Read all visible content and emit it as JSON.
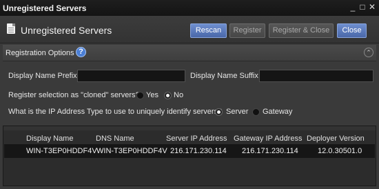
{
  "window": {
    "title": "Unregistered Servers",
    "controls": [
      "_",
      "□",
      "✕"
    ]
  },
  "header": {
    "title": "Unregistered Servers",
    "buttons": {
      "rescan": "Rescan",
      "register": "Register",
      "register_close": "Register & Close",
      "close": "Close"
    }
  },
  "section": {
    "label": "Registration Options",
    "help": "?",
    "collapse": "⌃"
  },
  "form": {
    "prefix_label": "Display Name Prefix",
    "prefix_value": "",
    "suffix_label": "Display Name Suffix",
    "suffix_value": "",
    "cloned_label": "Register selection as \"cloned\" servers?",
    "cloned_yes": "Yes",
    "cloned_no": "No",
    "cloned_selected": "No",
    "iptype_label": "What is the IP Address Type to use to uniquely identify servers?",
    "iptype_server": "Server",
    "iptype_gateway": "Gateway",
    "iptype_selected": "Server"
  },
  "table": {
    "columns": [
      "Display Name",
      "DNS Name",
      "Server IP Address",
      "Gateway IP Address",
      "Deployer Version"
    ],
    "rows": [
      [
        "WIN-T3EP0HDDF4V",
        "WIN-T3EP0HDDF4V",
        "216.171.230.114",
        "216.171.230.114",
        "12.0.30501.0"
      ]
    ]
  },
  "colors": {
    "primary_button": "#5a7bbf",
    "titlebar": "#1a1a1a",
    "panel": "#3a3a3a",
    "selected_row": "#161616"
  }
}
